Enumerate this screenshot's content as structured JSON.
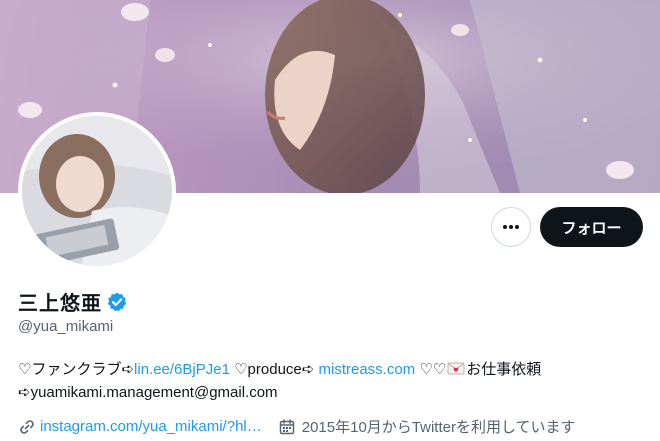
{
  "profile": {
    "display_name": "三上悠亜",
    "handle": "@yua_mikami",
    "verified": true
  },
  "actions": {
    "more_label": "•••",
    "follow_label": "フォロー"
  },
  "bio": {
    "line1_part1": "♡ファンクラブ➪",
    "fanclub_link": "lin.ee/6BjPJe1",
    "line1_part2": " ♡produce➪ ",
    "produce_link": "mistreass.com",
    "line1_part3": " ♡♡",
    "line1_part4": "お仕事依頼",
    "line2": "➪yuamikami.management@gmail.com"
  },
  "meta": {
    "website": "instagram.com/yua_mikami/?hl…",
    "joined": "2015年10月からTwitterを利用しています"
  },
  "colors": {
    "accent": "#1d9bf0",
    "text": "#0f1419",
    "secondary": "#536471",
    "button_dark": "#0f1419"
  },
  "icons": {
    "verified": "verified-badge-icon",
    "link": "link-icon",
    "calendar": "calendar-icon",
    "more": "more-icon",
    "mail": "love-letter-icon"
  }
}
